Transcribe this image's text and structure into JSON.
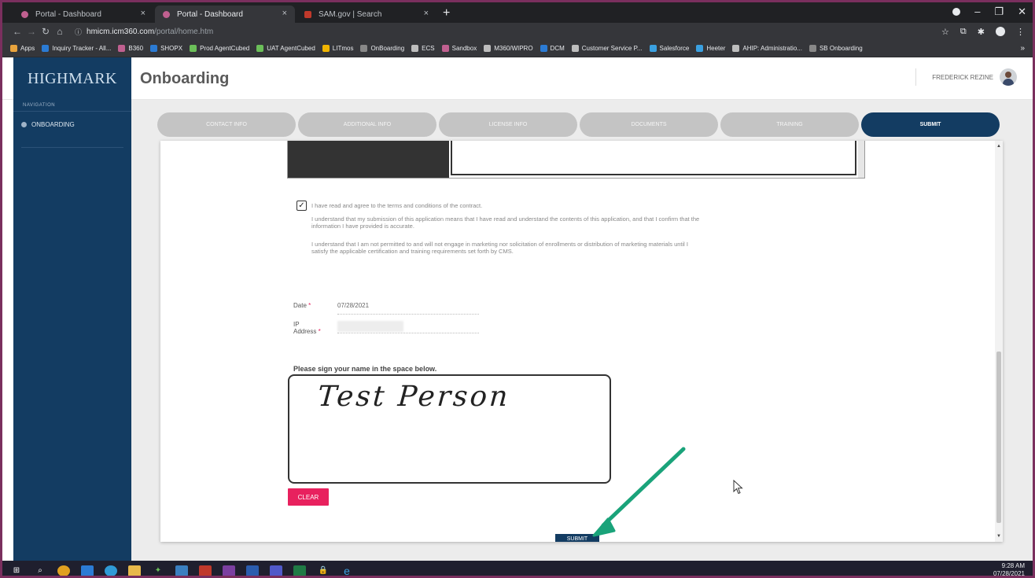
{
  "browser": {
    "tabs": [
      {
        "label": "Portal - Dashboard",
        "active": false
      },
      {
        "label": "Portal - Dashboard",
        "active": true
      },
      {
        "label": "SAM.gov | Search",
        "active": false
      }
    ],
    "new_tab": "+",
    "url_host": "hmicm.icm360.com",
    "url_path": "/portal/home.htm",
    "bookmarks": [
      {
        "label": "Apps",
        "color": "#e8a33d"
      },
      {
        "label": "Inquiry Tracker - All...",
        "color": "#2b7bd4"
      },
      {
        "label": "B360",
        "color": "#c06090"
      },
      {
        "label": "SHOPX",
        "color": "#2b7bd4"
      },
      {
        "label": "Prod AgentCubed",
        "color": "#6bbf59"
      },
      {
        "label": "UAT AgentCubed",
        "color": "#6bbf59"
      },
      {
        "label": "LITmos",
        "color": "#f0b400"
      },
      {
        "label": "OnBoarding",
        "color": "#888888"
      },
      {
        "label": "ECS",
        "color": "#bdbdbd"
      },
      {
        "label": "Sandbox",
        "color": "#c06090"
      },
      {
        "label": "M360/WIPRO",
        "color": "#bdbdbd"
      },
      {
        "label": "DCM",
        "color": "#2b7bd4"
      },
      {
        "label": "Customer Service P...",
        "color": "#bdbdbd"
      },
      {
        "label": "Salesforce",
        "color": "#3aa0e0"
      },
      {
        "label": "Heeter",
        "color": "#3aa0e0"
      },
      {
        "label": "AHIP: Administratio...",
        "color": "#bdbdbd"
      },
      {
        "label": "SB Onboarding",
        "color": "#888888"
      }
    ],
    "bookmarks_more": "»"
  },
  "app": {
    "logo": "HIGHMARK",
    "title": "Onboarding",
    "user_name": "FREDERICK REZINE"
  },
  "sidebar": {
    "heading": "NAVIGATION",
    "items": [
      {
        "label": "ONBOARDING"
      }
    ]
  },
  "wizard": {
    "steps": [
      {
        "label": "CONTACT INFO",
        "active": false
      },
      {
        "label": "ADDITIONAL INFO",
        "active": false
      },
      {
        "label": "LICENSE INFO",
        "active": false
      },
      {
        "label": "DOCUMENTS",
        "active": false
      },
      {
        "label": "TRAINING",
        "active": false
      },
      {
        "label": "SUBMIT",
        "active": true
      }
    ]
  },
  "form": {
    "agree_checked": true,
    "agree_label": "I have read and agree to the terms and conditions of the contract.",
    "para1": "I understand that my submission of this application means that I have read and understand the contents of this application, and that I confirm that the information I have provided is accurate.",
    "para2": "I understand that I am not permitted to and will not engage in marketing nor solicitation of enrollments or distribution of marketing materials until I satisfy the applicable certification and training requirements set forth by CMS.",
    "date_label": "Date",
    "date_value": "07/28/2021",
    "ip_label_1": "IP",
    "ip_label_2": "Address",
    "required_mark": "*",
    "sign_prompt": "Please sign your name in the space below.",
    "signature": "Test Person",
    "clear_label": "CLEAR",
    "submit_label": "SUBMIT"
  },
  "taskbar": {
    "time": "9:28 AM",
    "date": "07/28/2021"
  },
  "colors": {
    "brand_navy": "#133c62",
    "accent_pink": "#e8215e",
    "annotation_arrow": "#1aa37a",
    "frame_border": "#7a2f5e"
  }
}
